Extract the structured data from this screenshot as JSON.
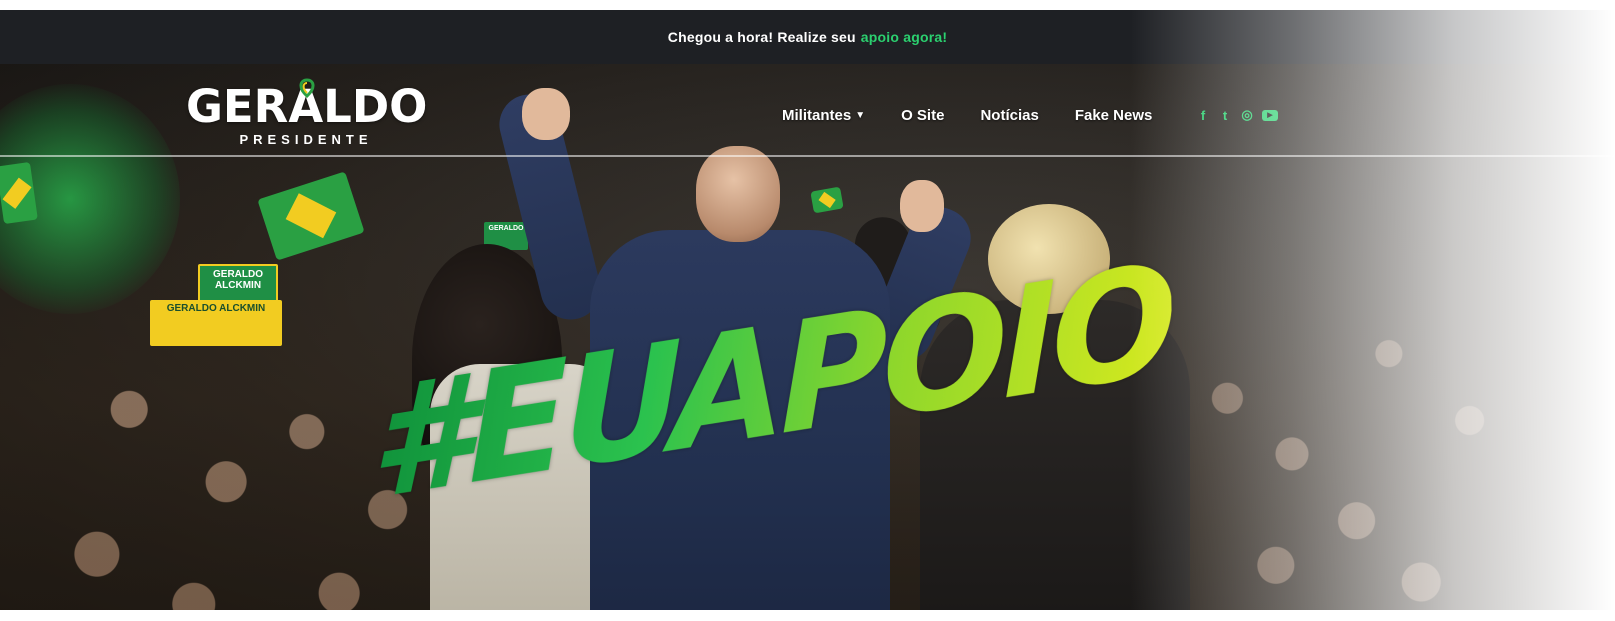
{
  "topbar": {
    "text": "Chegou a hora! Realize seu",
    "link": "apoio agora!"
  },
  "logo": {
    "name": "GERALDO",
    "subtitle": "PRESIDENTE"
  },
  "nav": {
    "items": [
      {
        "label": "Militantes",
        "has_dropdown": true
      },
      {
        "label": "O Site"
      },
      {
        "label": "Notícias"
      },
      {
        "label": "Fake News"
      }
    ]
  },
  "socials": {
    "facebook": "f",
    "twitter": "t",
    "instagram": "◎",
    "youtube": "▶"
  },
  "hero": {
    "hashtag": "#EUAPOIO",
    "sign_1": "GERALDO ALCKMIN",
    "sign_2": "GERALDO ALCKMIN",
    "sign_3": "GERALDO"
  },
  "colors": {
    "accent_green": "#2bd06f",
    "topbar_bg": "#1e2024",
    "brazil_green": "#2aa043",
    "brazil_yellow": "#f2cc21"
  }
}
